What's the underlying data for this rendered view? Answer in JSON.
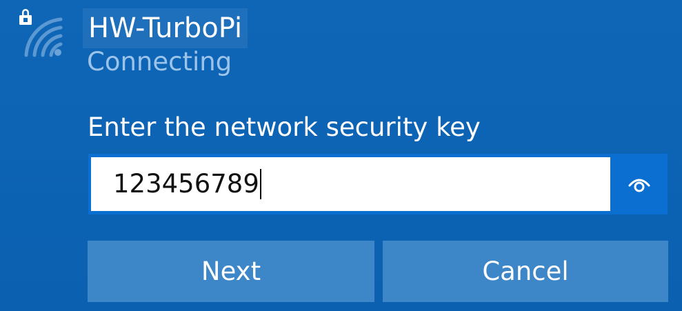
{
  "network": {
    "name": "HW-TurboPi",
    "status": "Connecting",
    "icon": "wifi-secured-icon"
  },
  "security_key": {
    "label": "Enter the network security key",
    "value": "123456789",
    "reveal_icon": "eye-icon"
  },
  "actions": {
    "next_label": "Next",
    "cancel_label": "Cancel"
  },
  "colors": {
    "panel_background": "#0d63b4",
    "button_background": "#3d86c8",
    "status_text": "#9cc4ea",
    "reveal_button_background": "#0a6fd0"
  }
}
